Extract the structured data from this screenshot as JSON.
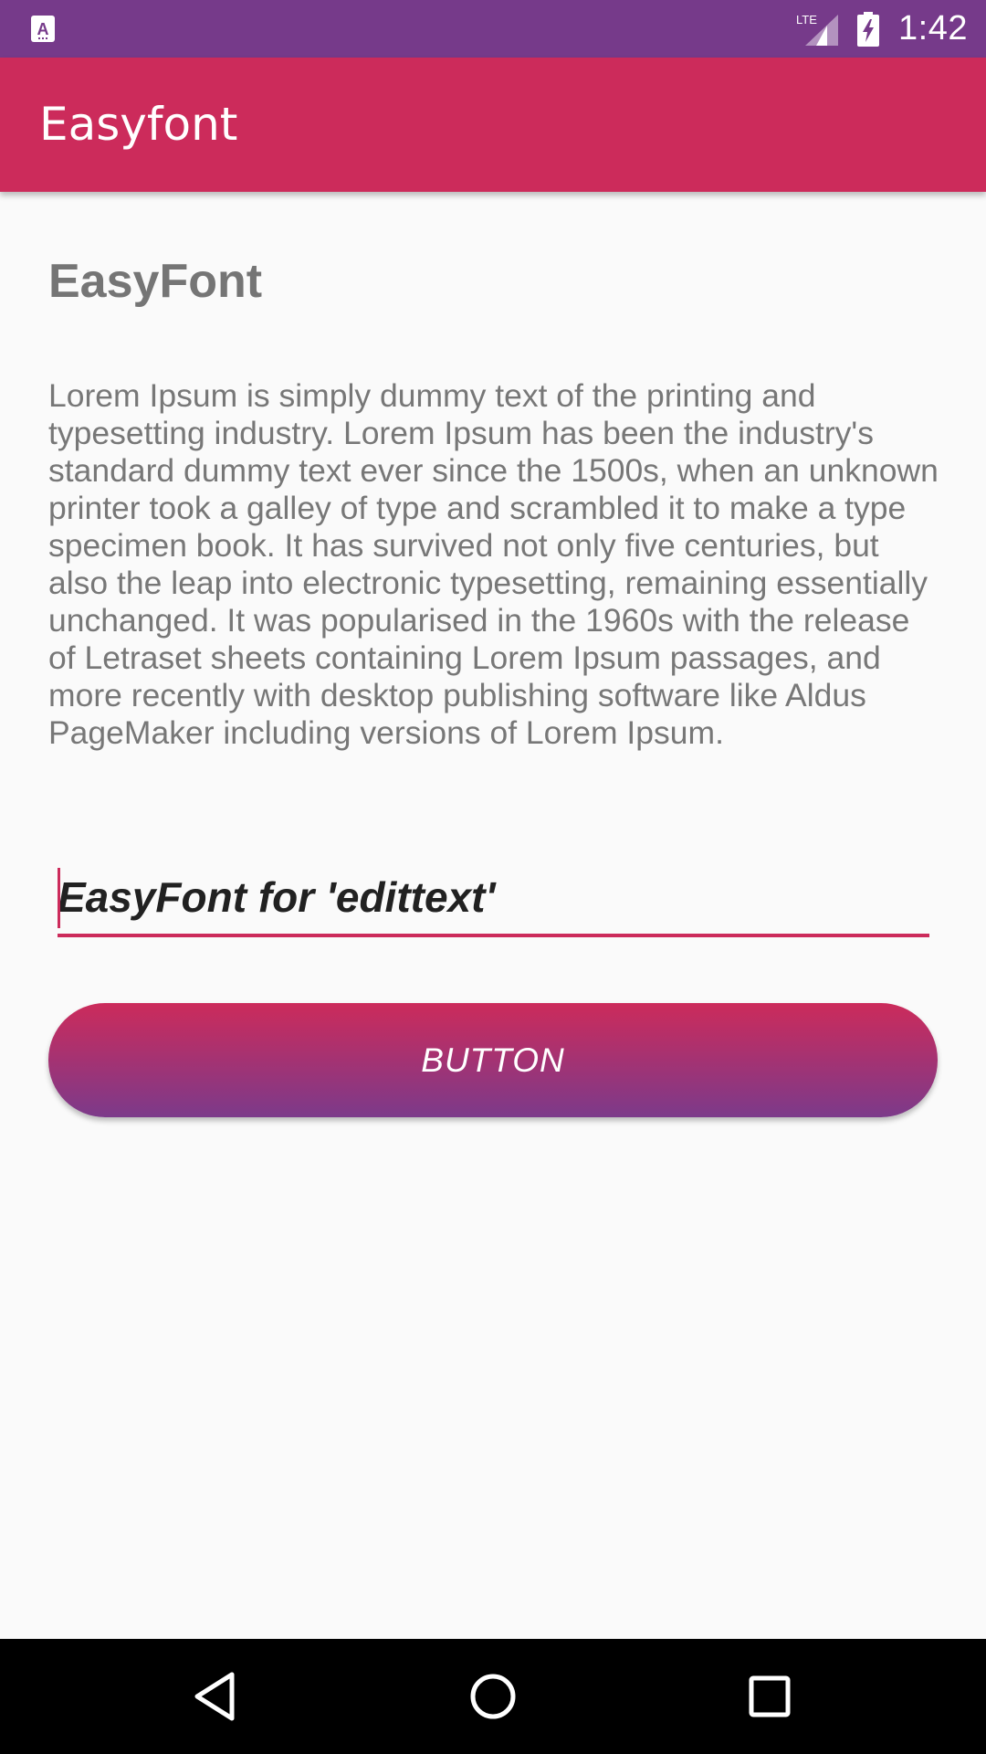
{
  "status_bar": {
    "time": "1:42",
    "network_label": "LTE",
    "left_icon": "text-a-icon",
    "icons": [
      "lte-signal-icon",
      "battery-charging-icon"
    ]
  },
  "app_bar": {
    "title": "Easyfont"
  },
  "content": {
    "title": "EasyFont",
    "body": "Lorem Ipsum is simply dummy text of the printing and typesetting industry. Lorem Ipsum has been the industry's standard dummy text ever since the 1500s, when an unknown printer took a galley of type and scrambled it to make a type specimen book. It has survived not only five centuries, but also the leap into electronic typesetting, remaining essentially unchanged. It was popularised in the 1960s with the release of Letraset sheets containing Lorem Ipsum passages, and more recently with desktop publishing software like Aldus PageMaker including versions of Lorem Ipsum."
  },
  "edit_text": {
    "value": "EasyFont for 'edittext'"
  },
  "button": {
    "label": "BUTTON"
  },
  "nav_bar": {
    "icons": [
      "back-icon",
      "home-icon",
      "recents-icon"
    ]
  },
  "colors": {
    "status_bar": "#763a8a",
    "app_bar": "#cc2b5b",
    "accent": "#cc2b5b",
    "button_gradient_top": "#cc2b5b",
    "button_gradient_bottom": "#7c3a8a",
    "background": "#fafafa",
    "nav_bar": "#000000"
  }
}
